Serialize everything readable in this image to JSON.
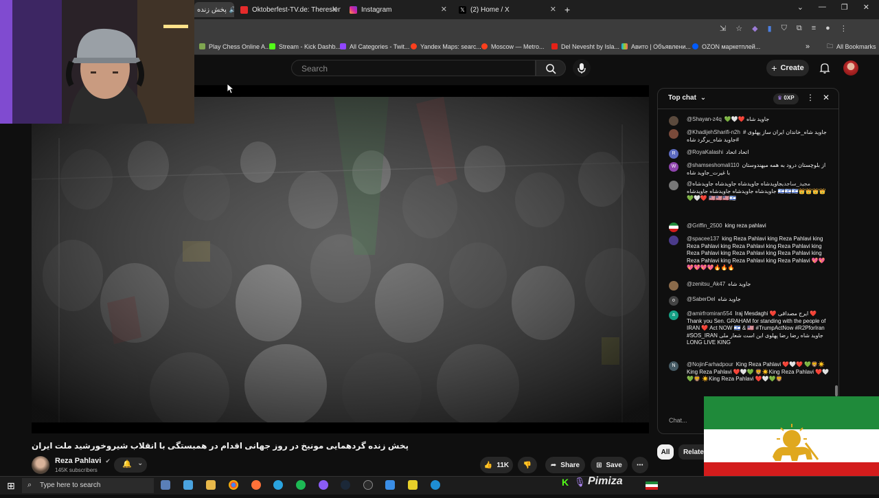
{
  "browser": {
    "tabs": [
      {
        "label": "پخش زنده",
        "active": true
      },
      {
        "label": "Oktoberfest-TV.de: Theresienw"
      },
      {
        "label": "Instagram"
      },
      {
        "label": "(2) Home / X"
      }
    ],
    "new_tab_symbol": "+",
    "bookmarks": [
      "Play Chess Online A...",
      "Stream - Kick Dashb...",
      "All Categories - Twit...",
      "Yandex Maps: searc...",
      "Moscow — Metro...",
      "Del Nevesht by Isla...",
      "Авито | Объявлени...",
      "OZON маркетплей..."
    ],
    "bookmarks_overflow": "»",
    "all_bookmarks": "All Bookmarks"
  },
  "youtube": {
    "search_placeholder": "Search",
    "create_label": "Create"
  },
  "video": {
    "title": "پخش زنده گردهمایی مونیخ در روز جهانی اقدام در همبستگی با انقلاب شیروخورشید ملت ایران",
    "channel_name": "Reza Pahlavi",
    "subscribers": "145K subscribers",
    "likes": "11K",
    "share_label": "Share",
    "save_label": "Save"
  },
  "chat": {
    "mode_label": "Top chat",
    "points_label": "0XP",
    "input_placeholder": "Chat...",
    "messages": [
      {
        "user": "@Shayan-z4q",
        "text": "💚🤍❤️ جاوید شاه"
      },
      {
        "user": "@KhadijehSharifi-n2h",
        "text": "جاوید شاه_خاندان ایران ساز پهلوی # #جاوید شاه_برگرد شاه"
      },
      {
        "user": "@RoyaKalashi",
        "text": "اتحاد اتحاد"
      },
      {
        "user": "@shamseshomali110",
        "text": "از بلوچستان درود به همه میهندوستان با غیرت_جاوید شاه"
      },
      {
        "user": "@مجید_ساجدی",
        "text": "جاویدشاه جاویدشاه جاویدشاه جاویدشاه جاویدشاه جاویدشاه جاویدشاه جاویدشاه 🇮🇱🇮🇱🇮🇱👑👑👑👑💚🤍❤️ 🇺🇸🇺🇸🇺🇸🇮🇱"
      },
      {
        "user": "@Griffin_2500",
        "text": "king reza pahlavi"
      },
      {
        "user": "@spacee137",
        "text": "king Reza Pahlavi king Reza Pahlavi king Reza Pahlavi king Reza Pahlavi king Reza Pahlavi king Reza Pahlavi king Reza Pahlavi king Reza Pahlavi king Reza Pahlavi king Reza Pahlavi king Reza Pahlavi 💖💖💖💖💖💖🔥🔥🔥"
      },
      {
        "user": "@zenitsu_Ak47",
        "text": "جاوید شاه"
      },
      {
        "user": "@SaberDel",
        "text": "جاوید شاه"
      },
      {
        "user": "@amirfromiran554",
        "text": "Iraj Mesdaghi ❤️ ایرج مصداقی ❤️ Thank you Sen. GRAHAM for standing with the people of IRAN ❤️ Act NOW 🇮🇱 & 🇺🇸 #TrumpActNow #R2PforIran #SOS_IRAN جاوید شاه رضا رضا پهلوی این است شعار ملی LONG LIVE KING"
      },
      {
        "user": "@NojinFarhadpour",
        "text": "King Reza Pahlavi ❤️🤍❤️ 💚🦁☀️King Reza Pahlavi ❤️🤍💚 🦁☀️King Reza Pahlavi ❤️🤍💚🦁 ☀️King Reza Pahlavi ❤️🤍💚🦁"
      }
    ]
  },
  "filter_chips": [
    "All",
    "Related"
  ],
  "taskbar": {
    "search_placeholder": "Type here to search",
    "overlay_brand": "Pimiza"
  },
  "colors": {
    "youtube_red": "#ff0000",
    "flag_green": "#1f8a3a",
    "flag_red": "#d31c1c",
    "lion_gold": "#e0a81e"
  }
}
